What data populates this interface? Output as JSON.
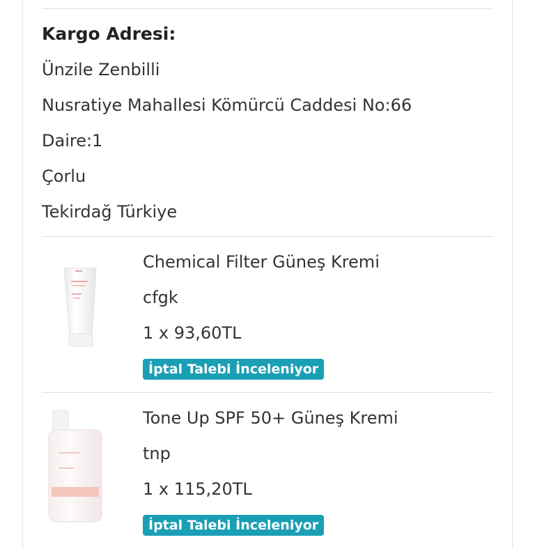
{
  "shipping_address": {
    "title": "Kargo Adresi:",
    "name": "Ünzile Zenbilli",
    "street": "Nusratiye Mahallesi Kömürcü Caddesi No:66",
    "unit": "Daire:1",
    "district": "Çorlu",
    "city_country": "Tekirdağ Türkiye"
  },
  "items": [
    {
      "name": "Chemical Filter Güneş Kremi",
      "variant": "cfgk",
      "qty_price": "1 x 93,60TL",
      "status": "İptal Talebi İnceleniyor",
      "image_icon": "sunscreen-tube-icon"
    },
    {
      "name": "Tone Up SPF 50+ Güneş Kremi",
      "variant": "tnp",
      "qty_price": "1 x 115,20TL",
      "status": "İptal Talebi İnceleniyor",
      "image_icon": "sunscreen-bottle-icon"
    }
  ],
  "colors": {
    "status_badge": "#1a9fb5"
  }
}
